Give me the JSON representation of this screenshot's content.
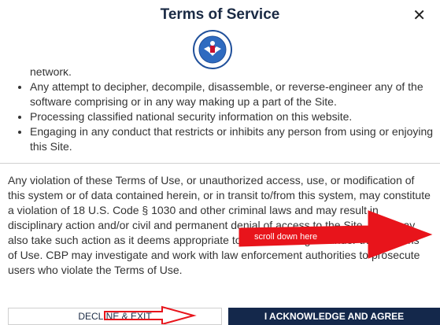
{
  "dialog": {
    "title": "Terms of Service",
    "close_glyph": "✕"
  },
  "bullets": [
    "network.",
    "Any attempt to decipher, decompile, disassemble, or reverse-engineer any of the software comprising or in any way making up a part of the Site.",
    "Processing classified national security information on this website.",
    "Engaging in any conduct that restricts or inhibits any person from using or enjoying this Site."
  ],
  "paragraph": "Any violation of these Terms of Use, or unauthorized access, use, or modification of this system or of data contained herein, or in transit to/from this system, may constitute a violation of 18 U.S. Code § 1030 and other criminal laws and may result in disciplinary action and/or civil and permanent denial of access to the Site. CBP may also take such action as it deems appropriate to enforce its rights under these Terms of Use. CBP may investigate and work with law enforcement authorities to prosecute users who violate the Terms of Use.",
  "buttons": {
    "decline": "DECLINE & EXIT",
    "agree": "I ACKNOWLEDGE AND AGREE"
  },
  "annotation": {
    "label": "scroll down here",
    "color": "#e8141b"
  },
  "colors": {
    "navy": "#14284b",
    "seal_blue": "#1f4f9a"
  },
  "icons": {
    "seal": "cbp-seal-icon",
    "close": "close-icon"
  }
}
